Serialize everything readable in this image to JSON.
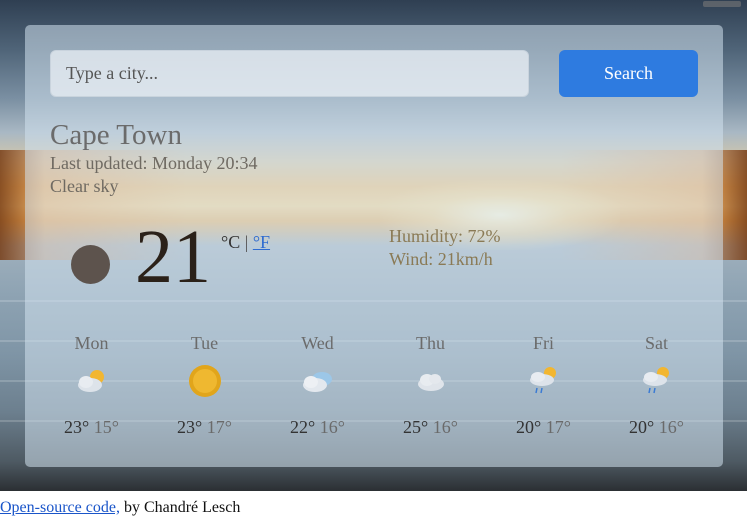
{
  "search": {
    "placeholder": "Type a city...",
    "button_label": "Search"
  },
  "weather": {
    "city": "Cape Town",
    "last_updated": "Last updated: Monday 20:34",
    "description": "Clear sky",
    "icon": "night-clear-icon",
    "temperature": "21",
    "unit_c": "°C",
    "separator": "|",
    "unit_f": "°F",
    "humidity": "Humidity: 72%",
    "wind": "Wind: 21km/h"
  },
  "forecast": [
    {
      "day": "Mon",
      "icon": "partly-cloudy-icon",
      "max": "23°",
      "min": "15°"
    },
    {
      "day": "Tue",
      "icon": "sun-icon",
      "max": "23°",
      "min": "17°"
    },
    {
      "day": "Wed",
      "icon": "cloudy-icon",
      "max": "22°",
      "min": "16°"
    },
    {
      "day": "Thu",
      "icon": "cloud-icon",
      "max": "25°",
      "min": "16°"
    },
    {
      "day": "Fri",
      "icon": "sun-rain-icon",
      "max": "20°",
      "min": "17°"
    },
    {
      "day": "Sat",
      "icon": "sun-rain-icon",
      "max": "20°",
      "min": "16°"
    }
  ],
  "footer": {
    "link_text": "Open-source code,",
    "byline": " by Chandré Lesch"
  },
  "colors": {
    "accent": "#2e7be0",
    "link": "#1a55c9"
  }
}
